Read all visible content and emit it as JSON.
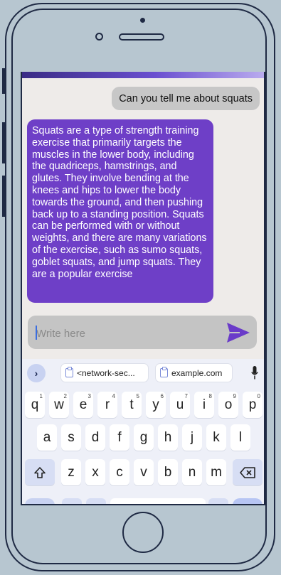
{
  "chat": {
    "user_message": "Can you tell me about squats",
    "bot_message": "Squats are a type of strength training exercise that primarily targets the muscles in the lower body, including the quadriceps, hamstrings, and glutes. They involve bending at the knees and hips to lower the body towards the ground, and then pushing back up to a standing position. Squats can be performed with or without weights, and there are many variations of the exercise, such as sumo squats, goblet squats, and jump squats. They are a popular exercise"
  },
  "composer": {
    "placeholder": "Write here",
    "send_icon": "send-icon"
  },
  "keyboard": {
    "suggestions": [
      "<network-sec...",
      "example.com"
    ],
    "row1": [
      "q",
      "w",
      "e",
      "r",
      "t",
      "y",
      "u",
      "i",
      "o",
      "p"
    ],
    "row1_hints": [
      "1",
      "2",
      "3",
      "4",
      "5",
      "6",
      "7",
      "8",
      "9",
      "0"
    ],
    "row2": [
      "a",
      "s",
      "d",
      "f",
      "g",
      "h",
      "j",
      "k",
      "l"
    ],
    "row3": [
      "z",
      "x",
      "c",
      "v",
      "b",
      "n",
      "m"
    ],
    "shift_icon": "shift-icon",
    "backspace_icon": "backspace-icon"
  },
  "colors": {
    "bot_bubble": "#6e3fc7",
    "user_bubble": "#c7c7c7",
    "send_accent": "#6a3bc9",
    "keyboard_bg": "#eef0f8"
  }
}
